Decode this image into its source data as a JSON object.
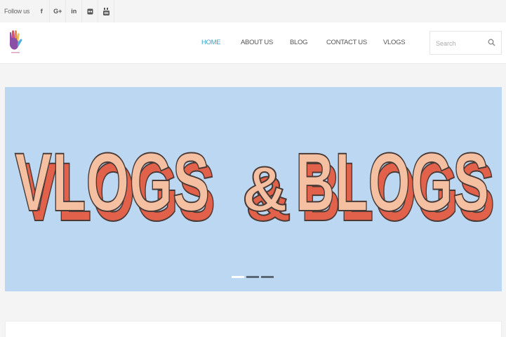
{
  "topbar": {
    "follow_label": "Follow us",
    "social": [
      {
        "name": "facebook-icon",
        "glyph": "f"
      },
      {
        "name": "google-plus-icon",
        "glyph": "G+"
      },
      {
        "name": "linkedin-icon",
        "glyph": "in"
      },
      {
        "name": "flickr-icon",
        "glyph": ""
      },
      {
        "name": "youtube-icon",
        "glyph": ""
      }
    ]
  },
  "header": {
    "nav": [
      {
        "label": "HOME",
        "active": true
      },
      {
        "label": "ABOUT US",
        "active": false
      },
      {
        "label": "BLOG",
        "active": false
      },
      {
        "label": "CONTACT US",
        "active": false
      },
      {
        "label": "VLOGS",
        "active": false
      }
    ],
    "search": {
      "placeholder": "Search",
      "value": ""
    }
  },
  "slider": {
    "headline_left": "VLOGS",
    "headline_mid": "&",
    "headline_right": "BLOGS",
    "slide_count": 3,
    "active_slide": 1,
    "colors": {
      "background": "#bcd7f1",
      "letter_fill": "#f4c0a1",
      "letter_shadow": "#e2614a",
      "outline": "#4a3a36"
    }
  },
  "colors": {
    "accent": "#3ea1c9",
    "page_bg": "#f4f4f4"
  }
}
